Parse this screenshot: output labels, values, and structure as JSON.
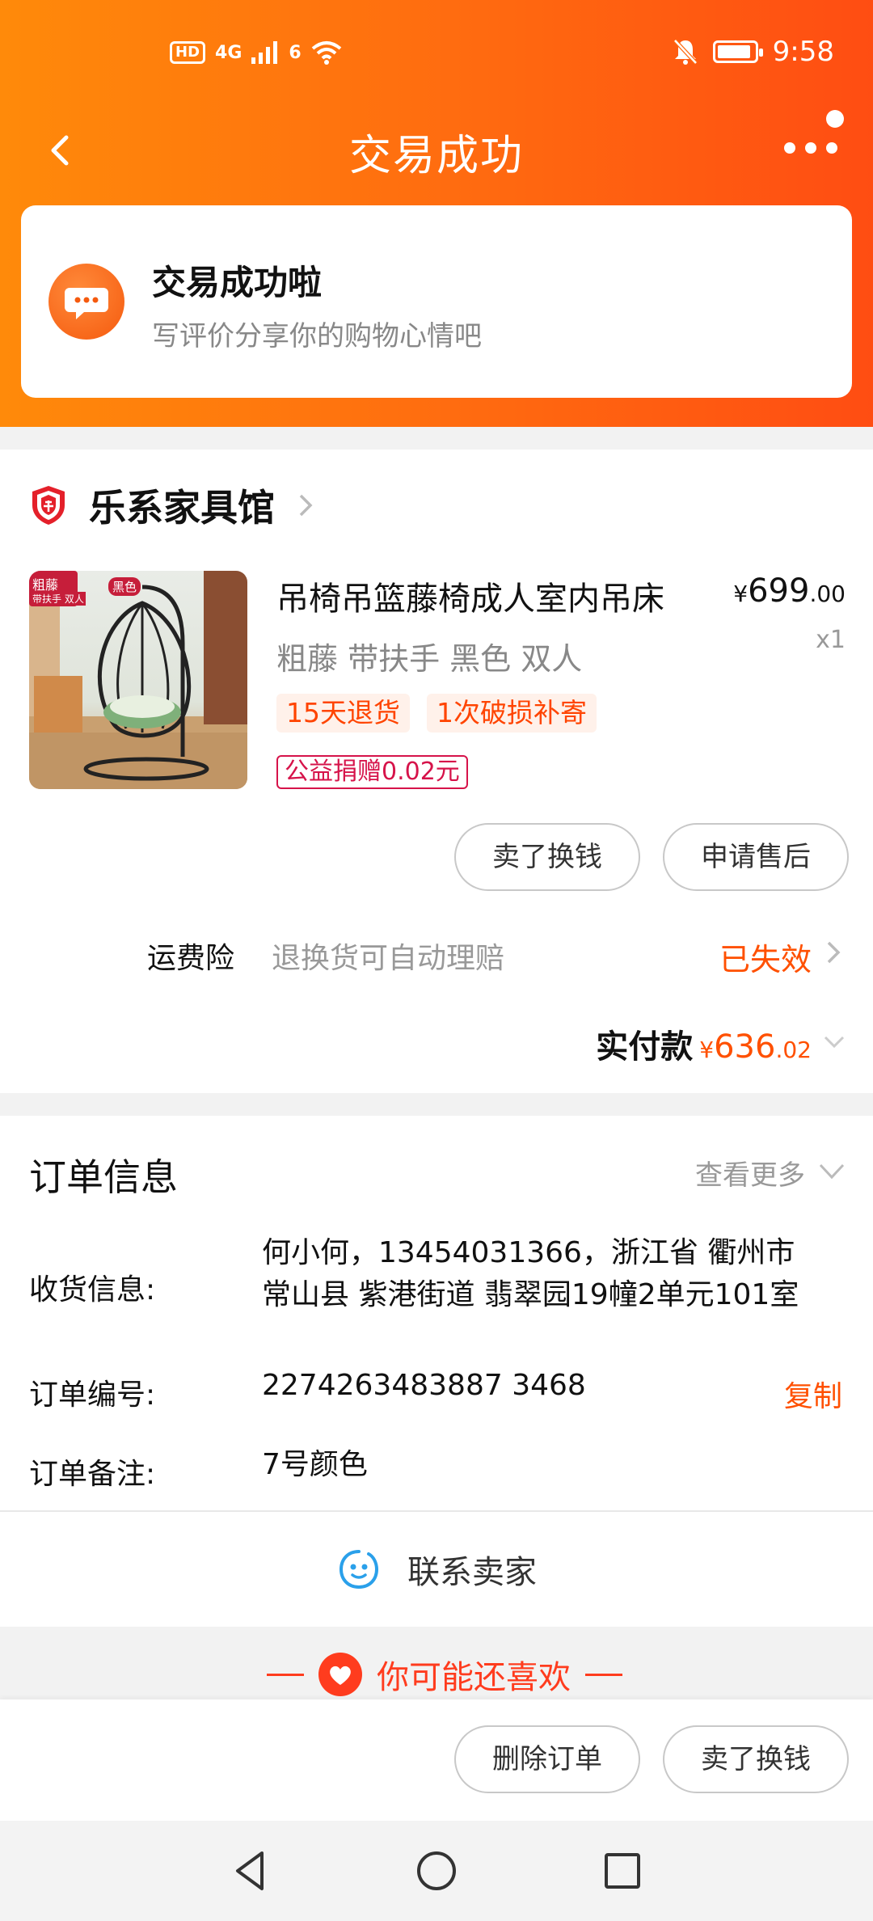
{
  "theme": {
    "accent": "#ff5000",
    "header_gradient": [
      "#ff8a0a",
      "#ff4d12"
    ],
    "tag_red": "#d6134a"
  },
  "status_bar": {
    "network_label": "HD",
    "signal_type": "4G",
    "wifi_tag": "6",
    "time": "9:58",
    "icons": [
      "hd-icon",
      "signal-icon",
      "wifi-icon",
      "mute-bell-icon",
      "battery-icon"
    ]
  },
  "nav": {
    "title": "交易成功",
    "back_icon": "chevron-left-icon",
    "more_icon": "more-dots-icon"
  },
  "success_card": {
    "icon": "chat-bubble-icon",
    "title": "交易成功啦",
    "subtitle": "写评价分享你的购物心情吧"
  },
  "order": {
    "shop_icon": "shop-badge-icon",
    "shop_name": "乐系家具馆",
    "product": {
      "image_tags": [
        "粗藤",
        "带扶手 双人",
        "黑色"
      ],
      "name": "吊椅吊篮藤椅成人室内吊床",
      "price_symbol": "¥",
      "price_int": "699",
      "price_dec": ".00",
      "qty": "x1",
      "spec": "粗藤 带扶手 黑色 双人",
      "tags": [
        "15天退货",
        "1次破损补寄"
      ],
      "donation": "公益捐赠0.02元"
    },
    "actions": [
      "卖了换钱",
      "申请售后"
    ],
    "insurance": {
      "label": "运费险",
      "desc": "退换货可自动理赔",
      "status": "已失效"
    },
    "paid": {
      "label": "实付款",
      "symbol": "¥",
      "int": "636",
      "dec": ".02"
    }
  },
  "info": {
    "title": "订单信息",
    "more": "查看更多",
    "address_label": "收货信息:",
    "address_line1": "何小何，13454031366，浙江省 衢州市",
    "address_line2": "常山县 紫港街道 翡翠园19幢2单元101室",
    "order_no_label": "订单编号:",
    "order_no": "2274263483887 3468",
    "copy": "复制",
    "note_label": "订单备注:",
    "note": "7号颜色",
    "contact": "联系卖家"
  },
  "recommend": {
    "title": "你可能还喜欢"
  },
  "bottom_actions": [
    "删除订单",
    "卖了换钱"
  ],
  "system_nav": [
    "back-triangle-icon",
    "home-circle-icon",
    "recents-square-icon"
  ]
}
